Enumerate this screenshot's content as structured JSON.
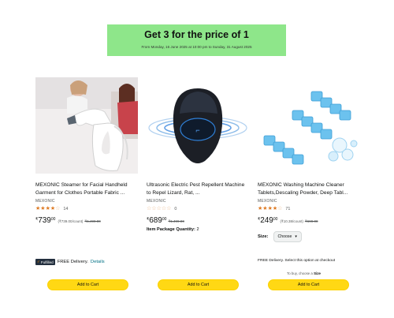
{
  "banner": {
    "title": "Get 3 for the price of 1",
    "subtitle": "From Monday, 16 June 2025 at 10:00 pm to Sunday, 31 August 2025"
  },
  "products": [
    {
      "title": "MEXONIC Steamer for Facial Handheld Garment for Clothes Portable Fabric ...",
      "brand": "MEXONIC",
      "rating": 3.5,
      "rating_count": "14",
      "price_currency": "₹",
      "price_whole": "739",
      "price_fraction": "00",
      "unit_price": "(₹739.00/count)",
      "mrp": "₹1,499.00",
      "delivery_badge": "Fulfilled",
      "delivery_text": "FREE Delivery.",
      "delivery_link": "Details",
      "button": "Add to Cart"
    },
    {
      "title": "Ultrasonic Electric Pest Repellent Machine to Repel Lizard, Rat, ...",
      "brand": "MEXONIC",
      "rating": 0,
      "rating_count": "0",
      "price_currency": "₹",
      "price_whole": "689",
      "price_fraction": "00",
      "mrp": "₹1,499.00",
      "package_label": "Item Package Quantity:",
      "package_value": "2",
      "button": "Add to Cart"
    },
    {
      "title": "MEXONIC Washing Machine Cleaner Tablets,Descaling Powder, Deep Tabl...",
      "brand": "MEXONIC",
      "rating": 3.5,
      "rating_count": "71",
      "price_currency": "₹",
      "price_whole": "249",
      "price_fraction": "00",
      "unit_price": "(₹10.38/count)",
      "mrp": "₹699.00",
      "size_label": "Size:",
      "size_value": "Choose",
      "delivery_text": "FREE Delivery. Select this option at checkout",
      "choose_prefix": "To buy, choose a",
      "choose_bold": "Size",
      "button": "Add to Cart"
    }
  ],
  "colors": {
    "banner_bg": "#8ee68a",
    "button_bg": "#ffd814",
    "star": "#de7921",
    "link": "#007185"
  }
}
